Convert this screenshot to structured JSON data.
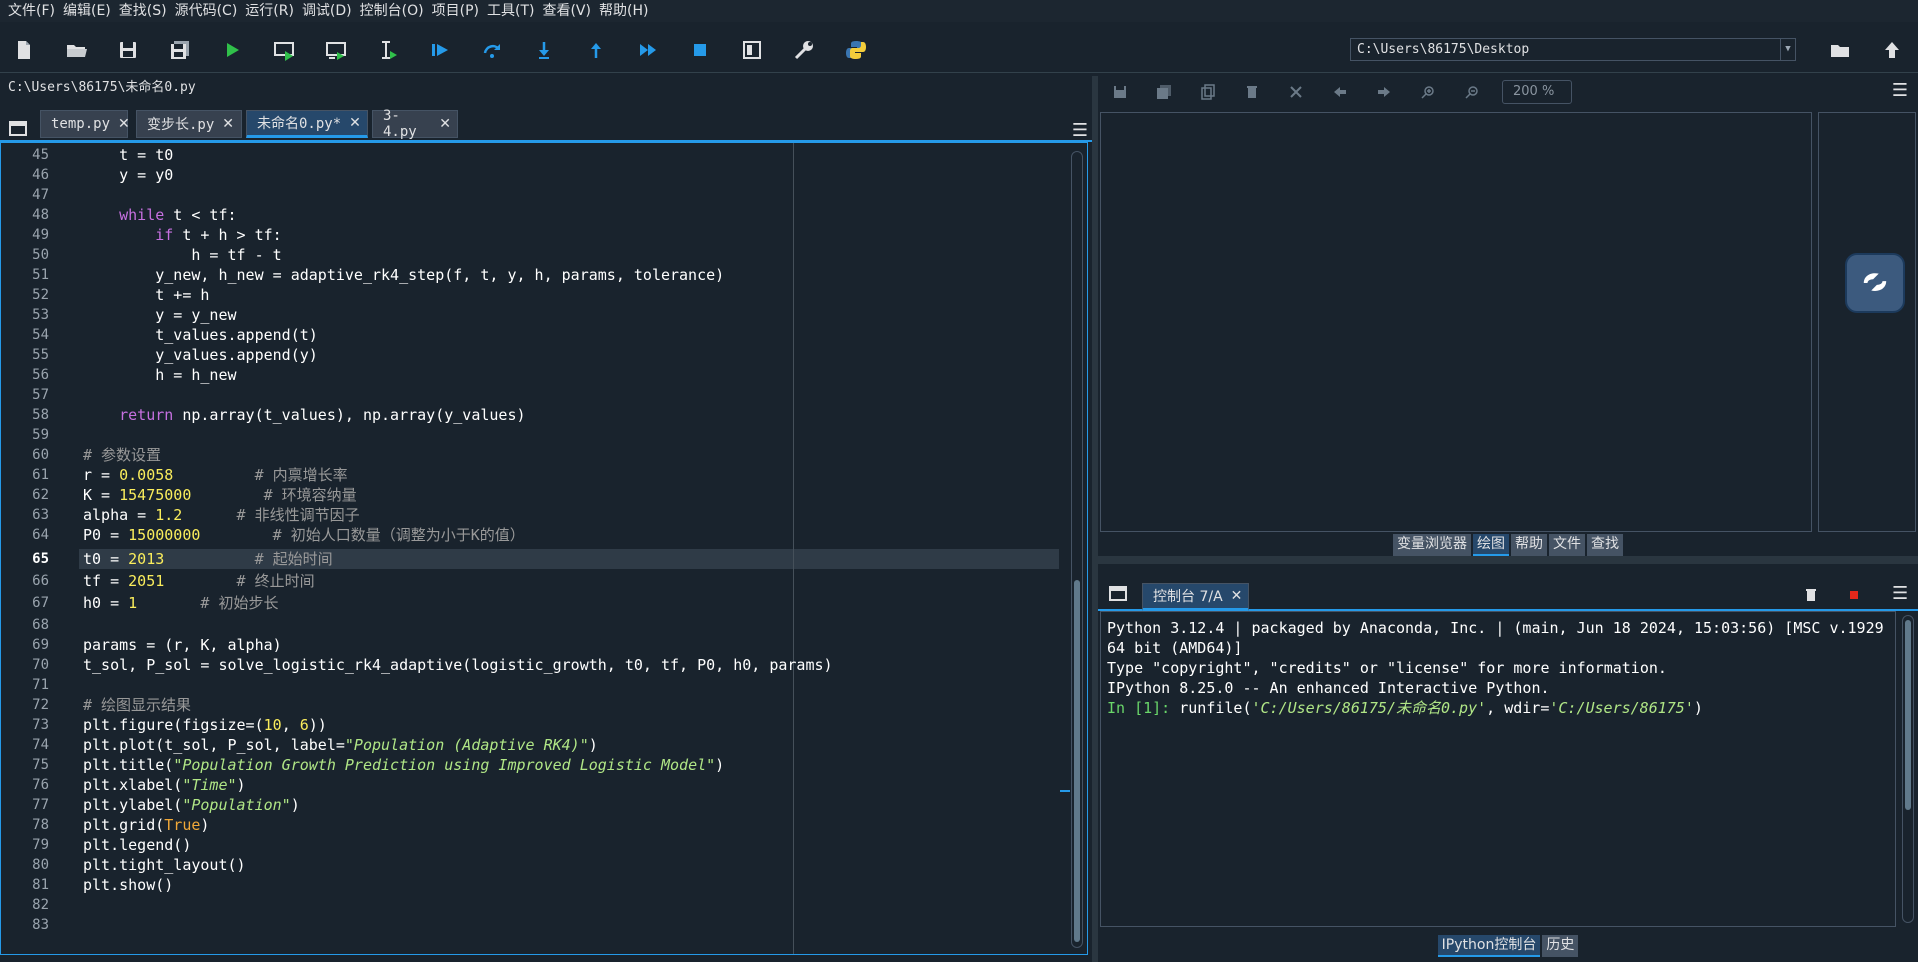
{
  "menu": [
    "文件(F)",
    "编辑(E)",
    "查找(S)",
    "源代码(C)",
    "运行(R)",
    "调试(D)",
    "控制台(O)",
    "项目(P)",
    "工具(T)",
    "查看(V)",
    "帮助(H)"
  ],
  "toolbar": {
    "icons": [
      "new-file-icon",
      "open-folder-icon",
      "save-icon",
      "save-all-icon",
      "run-icon",
      "run-cell-icon",
      "run-cell-advance-icon",
      "run-selection-icon",
      "debug-icon",
      "step-over-icon",
      "step-into-icon",
      "step-return-icon",
      "continue-icon",
      "stop-icon",
      "maximize-pane-icon",
      "preferences-wrench-icon",
      "python-path-icon"
    ],
    "working_dir": "C:\\Users\\86175\\Desktop"
  },
  "editor": {
    "file_path": "C:\\Users\\86175\\未命名0.py",
    "tabs": [
      {
        "label": "temp.py",
        "active": false
      },
      {
        "label": "变步长.py",
        "active": false
      },
      {
        "label": "未命名0.py*",
        "active": true
      },
      {
        "label": "3-4.py",
        "active": false
      }
    ],
    "close_glyph": "✕",
    "current_line": 65,
    "line_numbers": [
      "45",
      "46",
      "47",
      "48",
      "49",
      "50",
      "51",
      "52",
      "53",
      "54",
      "55",
      "56",
      "57",
      "58",
      "59",
      "60",
      "61",
      "62",
      "63",
      "64",
      "65",
      "66",
      "67",
      "68",
      "69",
      "70",
      "71",
      "72",
      "73",
      "74",
      "75",
      "76",
      "77",
      "78",
      "79",
      "80",
      "81",
      "82",
      "83"
    ]
  },
  "plots": {
    "zoom": "200 %",
    "tabs": [
      {
        "label": "变量浏览器",
        "active": false
      },
      {
        "label": "绘图",
        "active": true
      },
      {
        "label": "帮助",
        "active": false
      },
      {
        "label": "文件",
        "active": false
      },
      {
        "label": "查找",
        "active": false
      }
    ]
  },
  "console": {
    "tab_label": "控制台 7/A",
    "close_glyph": "✕",
    "lines": [
      "Python 3.12.4 | packaged by Anaconda, Inc. | (main, Jun 18 2024, 15:03:56) [MSC v.1929",
      "64 bit (AMD64)]",
      "Type \"copyright\", \"credits\" or \"license\" for more information.",
      "",
      "IPython 8.25.0 -- An enhanced Interactive Python.",
      ""
    ],
    "prompt": "In [1]: ",
    "command_prefix": "runfile(",
    "command_arg1": "'C:/Users/86175/未命名0.py'",
    "command_mid": ", wdir=",
    "command_arg2": "'C:/Users/86175'",
    "command_suffix": ")",
    "tabs": [
      {
        "label": "IPython控制台",
        "active": true
      },
      {
        "label": "历史",
        "active": false
      }
    ]
  },
  "colors": {
    "background": "#19232d",
    "accent": "#259ae9",
    "keyword": "#c670e0",
    "number": "#faed5c",
    "string": "#b0e686",
    "comment": "#999999",
    "bool": "#f0a838",
    "prompt": "#6ad76a"
  }
}
